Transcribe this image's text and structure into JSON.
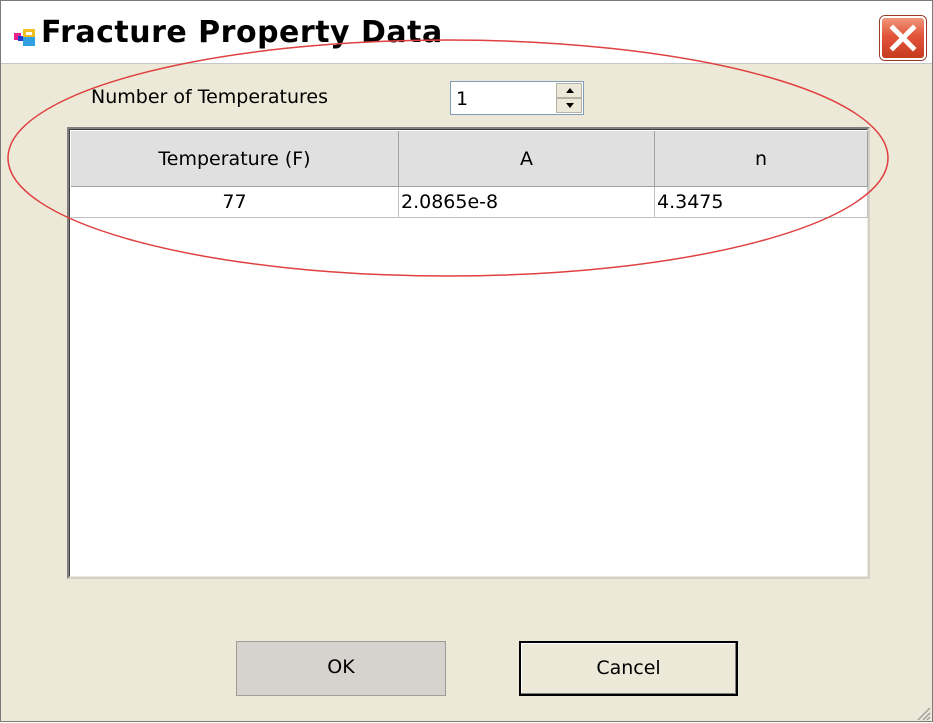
{
  "window": {
    "title": "Fracture Property Data",
    "close_icon": "close-icon",
    "app_icon": "app-icon",
    "colors": {
      "close_button": "#e2553a",
      "annotation_ellipse": "#e04040"
    }
  },
  "form": {
    "num_temperatures_label": "Number of Temperatures",
    "num_temperatures_value": "1"
  },
  "table": {
    "columns": [
      "Temperature (F)",
      "A",
      "n"
    ],
    "rows": [
      [
        "77",
        "2.0865e-8",
        "4.3475"
      ]
    ]
  },
  "buttons": {
    "ok": "OK",
    "cancel": "Cancel"
  }
}
